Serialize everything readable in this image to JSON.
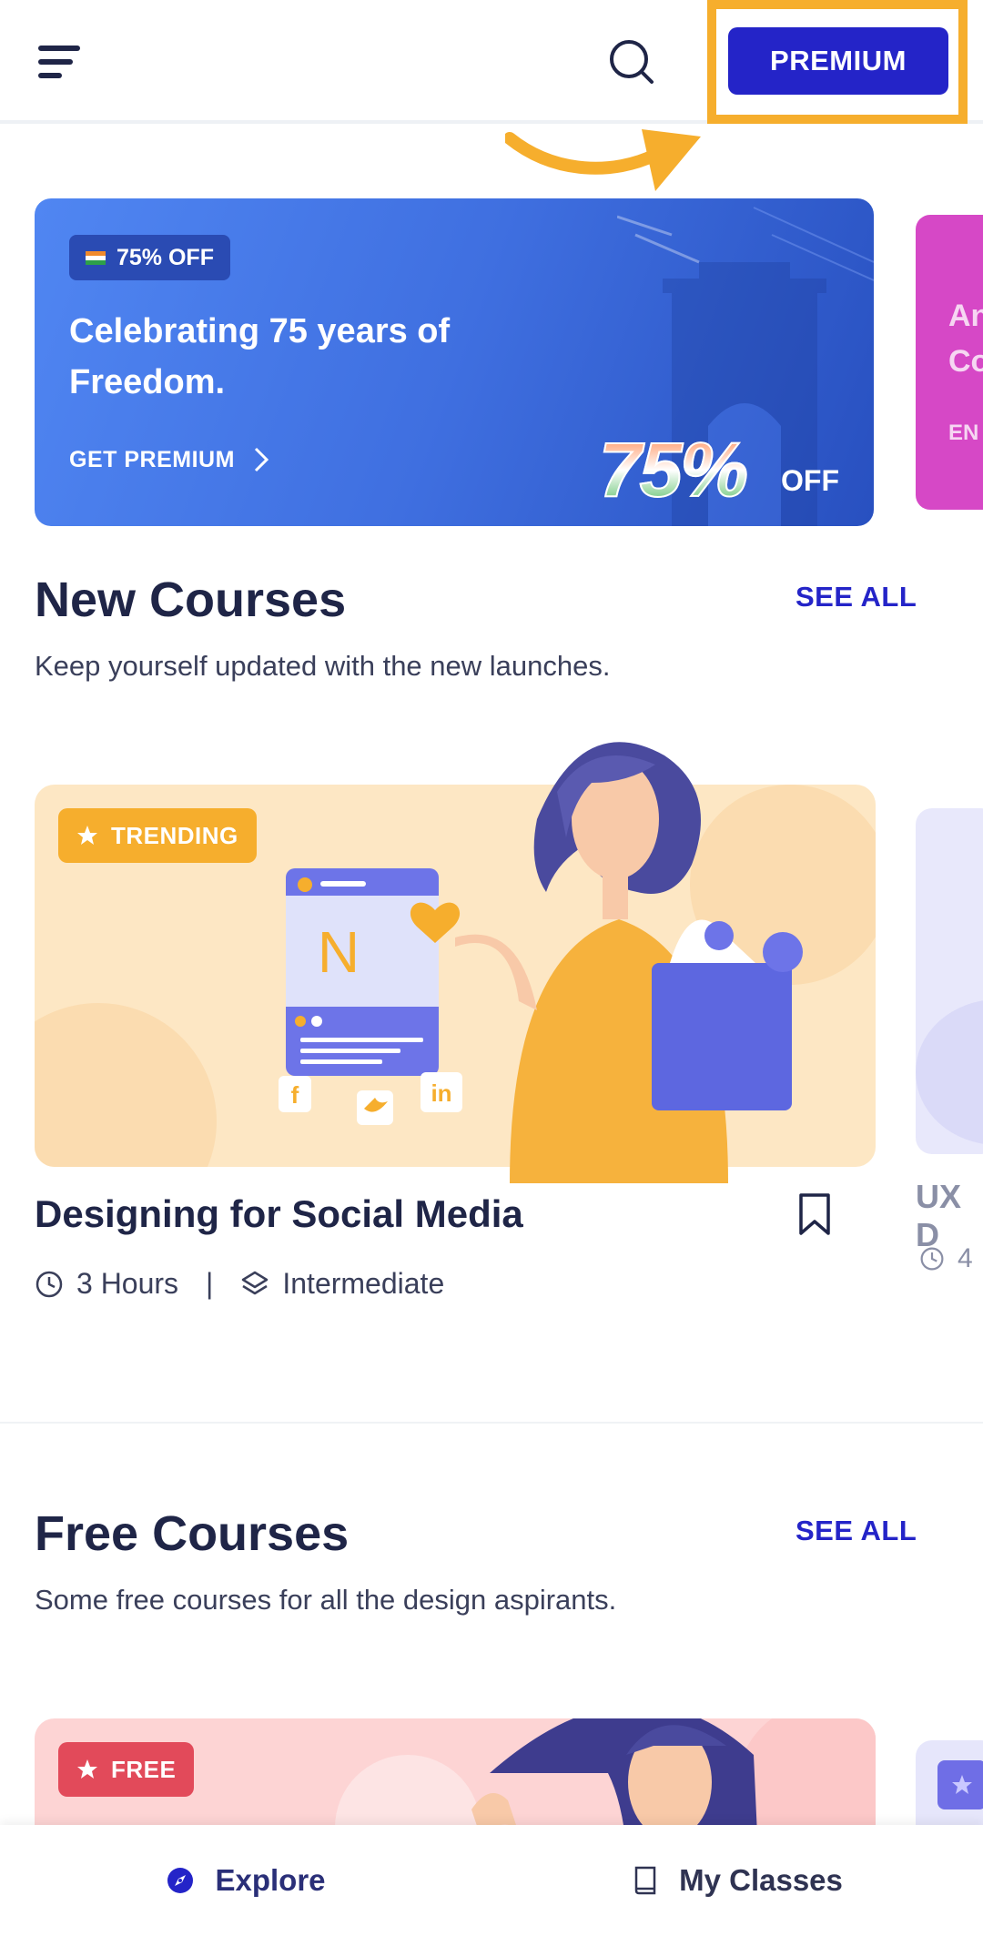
{
  "header": {
    "premium_label": "PREMIUM"
  },
  "banner": {
    "badge": "75% OFF",
    "title": "Celebrating 75 years of Freedom.",
    "cta": "GET PREMIUM",
    "big_number": "75%",
    "off_label": "OFF"
  },
  "banner_next": {
    "title_partial": "An\nCo",
    "cta_partial": "EN"
  },
  "new_courses": {
    "title": "New Courses",
    "see_all": "SEE ALL",
    "subtitle": "Keep yourself updated with the new launches.",
    "card": {
      "badge": "TRENDING",
      "illustration_letter": "N",
      "title": "Designing for Social Media",
      "duration": "3 Hours",
      "separator": "|",
      "level": "Intermediate"
    },
    "next_card": {
      "title_partial": "UX D",
      "duration_partial": "4"
    }
  },
  "free_courses": {
    "title": "Free Courses",
    "see_all": "SEE ALL",
    "subtitle": "Some free courses for all the design aspirants.",
    "card": {
      "badge": "FREE"
    }
  },
  "bottom_nav": {
    "items": [
      {
        "label": "Explore",
        "icon": "compass-icon",
        "active": true
      },
      {
        "label": "My Classes",
        "icon": "book-icon",
        "active": false
      }
    ]
  },
  "colors": {
    "accent": "#2424c8",
    "highlight": "#f6ae2d",
    "text": "#1f2547",
    "trending": "#f6ae2d",
    "free": "#e24a5a"
  }
}
